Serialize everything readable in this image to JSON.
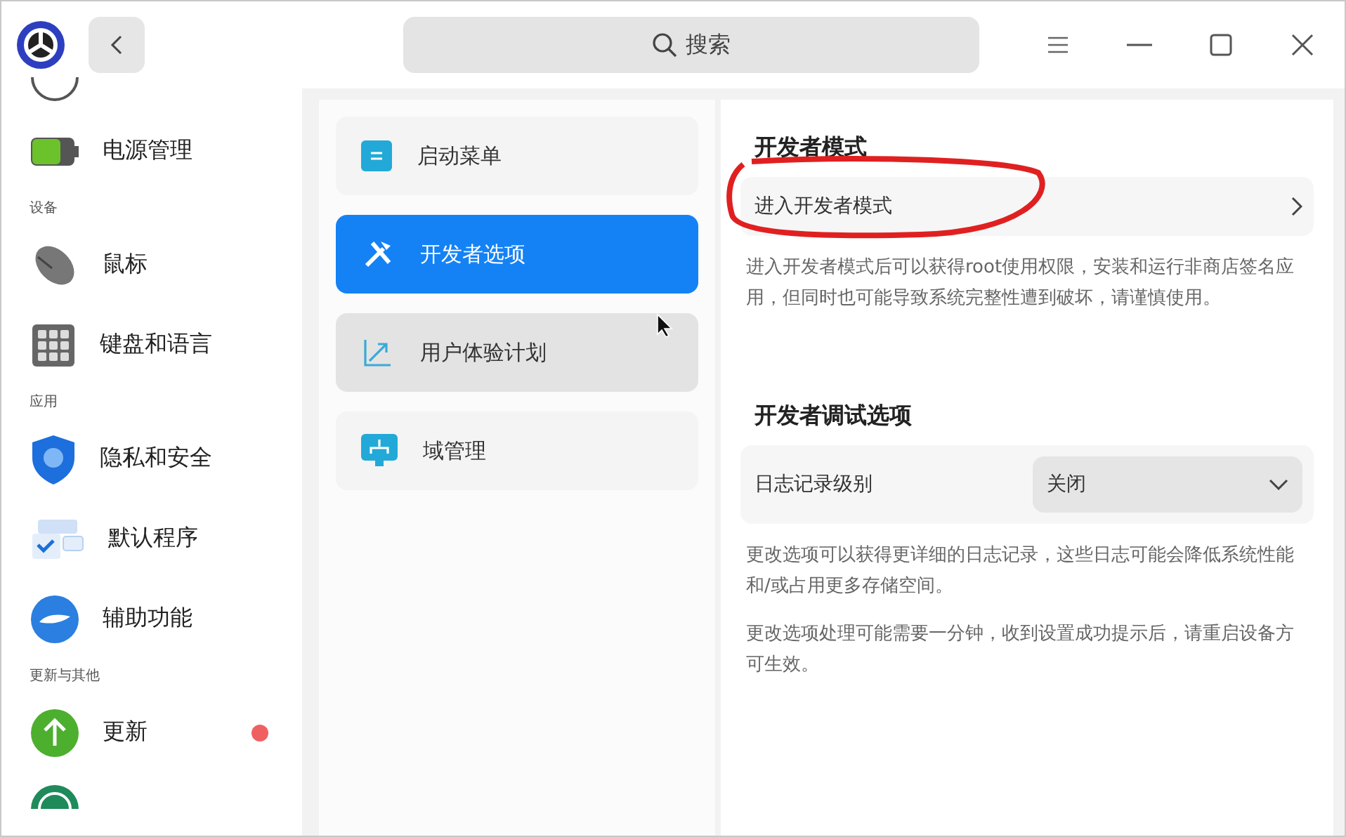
{
  "titlebar": {
    "search": {
      "placeholder": "搜索"
    }
  },
  "sidebar": {
    "items": [
      {
        "kind": "clipped"
      },
      {
        "kind": "item",
        "label": "电源管理",
        "badge": false
      },
      {
        "kind": "header",
        "label": "设备"
      },
      {
        "kind": "item",
        "label": "鼠标",
        "badge": false
      },
      {
        "kind": "item",
        "label": "键盘和语言",
        "badge": false
      },
      {
        "kind": "header",
        "label": "应用"
      },
      {
        "kind": "item",
        "label": "隐私和安全",
        "badge": false
      },
      {
        "kind": "item",
        "label": "默认程序",
        "badge": false
      },
      {
        "kind": "item",
        "label": "辅助功能",
        "badge": false
      },
      {
        "kind": "header",
        "label": "更新与其他"
      },
      {
        "kind": "item",
        "label": "更新",
        "badge": true
      },
      {
        "kind": "clipped"
      }
    ]
  },
  "menu": {
    "items": [
      {
        "label": "启动菜单",
        "selected": false,
        "hovered": false
      },
      {
        "label": "开发者选项",
        "selected": true,
        "hovered": false
      },
      {
        "label": "用户体验计划",
        "selected": false,
        "hovered": true
      },
      {
        "label": "域管理",
        "selected": false,
        "hovered": false
      }
    ]
  },
  "sections": [
    {
      "title": "开发者模式",
      "rows": [
        {
          "kind": "link",
          "label": "进入开发者模式"
        }
      ],
      "notes": [
        "进入开发者模式后可以获得root使用权限，安装和运行非商店签名应用，但同时也可能导致系统完整性遭到破坏，请谨慎使用。"
      ]
    },
    {
      "title": "开发者调试选项",
      "rows": [
        {
          "kind": "select",
          "label": "日志记录级别",
          "value": "关闭"
        }
      ],
      "notes": [
        "更改选项可以获得更详细的日志记录，这些日志可能会降低系统性能和/或占用更多存储空间。",
        "更改选项处理可能需要一分钟，收到设置成功提示后，请重启设备方可生效。"
      ]
    }
  ],
  "annotation": {
    "visible": true
  }
}
